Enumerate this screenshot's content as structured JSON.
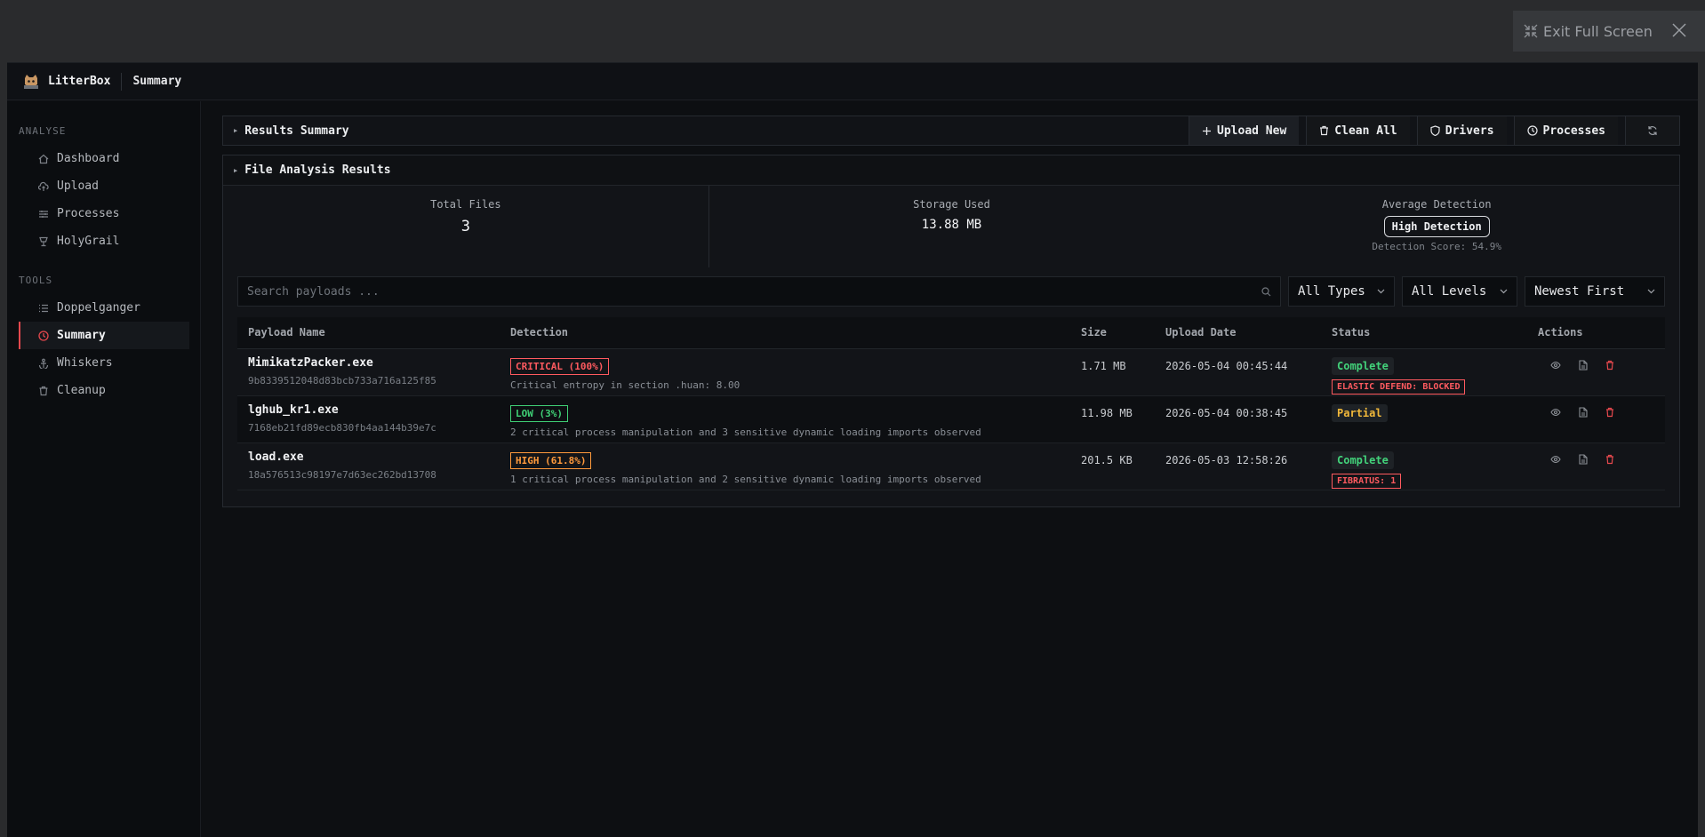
{
  "overlay": {
    "exit_label": "Exit Full Screen"
  },
  "app": {
    "name": "LitterBox",
    "page": "Summary"
  },
  "sidebar": {
    "sections": [
      {
        "title": "ANALYSE",
        "items": [
          {
            "label": "Dashboard",
            "icon": "home-icon"
          },
          {
            "label": "Upload",
            "icon": "upload-cloud-icon"
          },
          {
            "label": "Processes",
            "icon": "sliders-icon"
          },
          {
            "label": "HolyGrail",
            "icon": "chalice-icon"
          }
        ]
      },
      {
        "title": "TOOLS",
        "items": [
          {
            "label": "Doppelganger",
            "icon": "list-icon"
          },
          {
            "label": "Summary",
            "icon": "clock-icon",
            "active": true
          },
          {
            "label": "Whiskers",
            "icon": "anchor-icon"
          },
          {
            "label": "Cleanup",
            "icon": "trash-icon"
          }
        ]
      }
    ]
  },
  "results_bar": {
    "title": "Results Summary",
    "buttons": {
      "upload": "Upload New",
      "clean": "Clean All",
      "drivers": "Drivers",
      "processes": "Processes"
    }
  },
  "analysis": {
    "title": "File Analysis Results",
    "stats": {
      "total_files_label": "Total Files",
      "total_files": "3",
      "storage_label": "Storage Used",
      "storage": "13.88 MB",
      "avg_label": "Average Detection",
      "avg_value": "High Detection",
      "score": "Detection Score: 54.9%"
    },
    "search_placeholder": "Search payloads ...",
    "filters": {
      "type": "All Types",
      "level": "All Levels",
      "sort": "Newest First"
    },
    "columns": [
      "Payload Name",
      "Detection",
      "Size",
      "Upload Date",
      "Status",
      "Actions"
    ],
    "rows": [
      {
        "name": "MimikatzPacker.exe",
        "hash": "9b8339512048d83bcb733a716a125f85",
        "detection": "CRITICAL (100%)",
        "level": "critical",
        "desc": "Critical entropy in section .huan: 8.00",
        "size": "1.71 MB",
        "date": "2026-05-04 00:45:44",
        "status": "Complete",
        "status_type": "complete",
        "tag": "ELASTIC DEFEND: BLOCKED"
      },
      {
        "name": "lghub_kr1.exe",
        "hash": "7168eb21fd89ecb830fb4aa144b39e7c",
        "detection": "LOW (3%)",
        "level": "low",
        "desc": "2 critical process manipulation and 3 sensitive dynamic loading imports observed",
        "size": "11.98 MB",
        "date": "2026-05-04 00:38:45",
        "status": "Partial",
        "status_type": "partial",
        "tag": ""
      },
      {
        "name": "load.exe",
        "hash": "18a576513c98197e7d63ec262bd13708",
        "detection": "HIGH (61.8%)",
        "level": "high",
        "desc": "1 critical process manipulation and 2 sensitive dynamic loading imports observed",
        "size": "201.5 KB",
        "date": "2026-05-03 12:58:26",
        "status": "Complete",
        "status_type": "complete",
        "tag": "FIBRATUS: 1"
      }
    ]
  },
  "colors": {
    "accent_red": "#e5484d",
    "critical": "#ff5a5f",
    "low": "#3fcf75",
    "high": "#ff9a3c",
    "partial": "#f1b83a"
  }
}
